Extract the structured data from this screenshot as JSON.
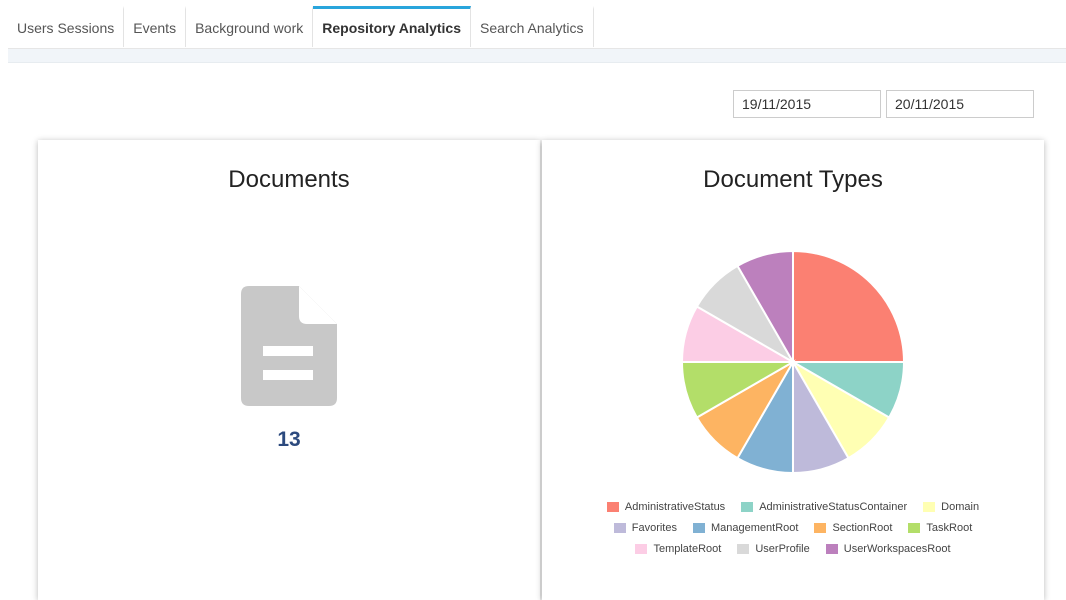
{
  "tabs": [
    {
      "label": "Users Sessions",
      "active": false
    },
    {
      "label": "Events",
      "active": false
    },
    {
      "label": "Background work",
      "active": false
    },
    {
      "label": "Repository Analytics",
      "active": true
    },
    {
      "label": "Search Analytics",
      "active": false
    }
  ],
  "date_range": {
    "from": "19/11/2015",
    "to": "20/11/2015"
  },
  "documents_card": {
    "title": "Documents",
    "icon": "document-icon",
    "count": "13"
  },
  "types_card": {
    "title": "Document Types"
  },
  "chart_data": {
    "type": "pie",
    "title": "Document Types",
    "categories": [
      "AdministrativeStatus",
      "AdministrativeStatusContainer",
      "Domain",
      "Favorites",
      "ManagementRoot",
      "SectionRoot",
      "TaskRoot",
      "TemplateRoot",
      "UserProfile",
      "UserWorkspacesRoot"
    ],
    "values": [
      25,
      8.33,
      8.33,
      8.33,
      8.33,
      8.33,
      8.33,
      8.33,
      8.33,
      8.33
    ],
    "colors": [
      "#fb8072",
      "#8dd3c7",
      "#ffffb3",
      "#bebada",
      "#80b1d3",
      "#fdb462",
      "#b3de69",
      "#fccde5",
      "#d9d9d9",
      "#bc80bd"
    ],
    "legend": "bottom"
  }
}
